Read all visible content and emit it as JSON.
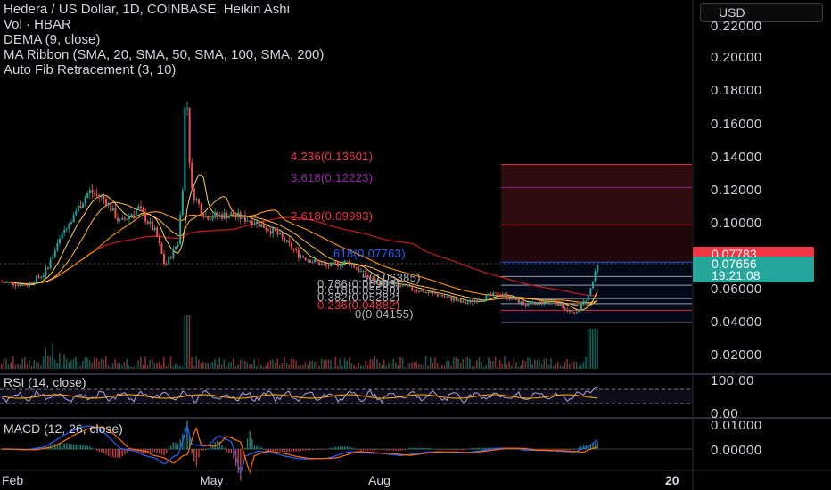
{
  "legend": {
    "title": "Hedera / US Dollar, 1D, COINBASE, Heikin Ashi",
    "volume": "Vol · HBAR",
    "dema": "DEMA (9, close)",
    "ma_ribbon": "MA Ribbon (SMA, 20, SMA, 50, SMA, 100, SMA, 200)",
    "fib": "Auto Fib Retracement (3, 10)"
  },
  "currency": "USD",
  "price_axis": [
    "0.22000",
    "0.20000",
    "0.18000",
    "0.16000",
    "0.14000",
    "0.12000",
    "0.10000",
    "0.06000",
    "0.04000",
    "0.02000"
  ],
  "price_tags": {
    "high": "0.07783",
    "last": "0.07656",
    "countdown": "19:21:08"
  },
  "fib_levels": [
    {
      "label": "4.236(0.13601)",
      "color": "#f23645"
    },
    {
      "label": "3.618(0.12223)",
      "color": "#9c27b0"
    },
    {
      "label": "2.618(0.09993)",
      "color": "#f23645"
    },
    {
      "label": ".618(0.07763)",
      "color": "#2962ff"
    },
    {
      "label": ".5(0.06385)",
      "color": "#b2b5be"
    },
    {
      "label": "0.786(0.06903)",
      "color": "#b2b5be"
    },
    {
      "label": "0.618(0.05590)",
      "color": "#b2b5be"
    },
    {
      "label": "0.382(0.05282)",
      "color": "#b2b5be"
    },
    {
      "label": "0.236(0.04882)",
      "color": "#f23645"
    },
    {
      "label": "0(0.04155)",
      "color": "#b2b5be"
    }
  ],
  "rsi": {
    "label": "RSI (14, close)",
    "axis": [
      "100.00",
      "0.00"
    ]
  },
  "macd": {
    "label": "MACD (12, 26, close)",
    "axis": [
      "0.01000",
      "0.00000"
    ]
  },
  "time_axis": [
    "Feb",
    "May",
    "Aug",
    "20"
  ],
  "colors": {
    "up": "#26a69a",
    "down": "#ef5350",
    "accent": "#2962ff",
    "background": "#000000"
  }
}
